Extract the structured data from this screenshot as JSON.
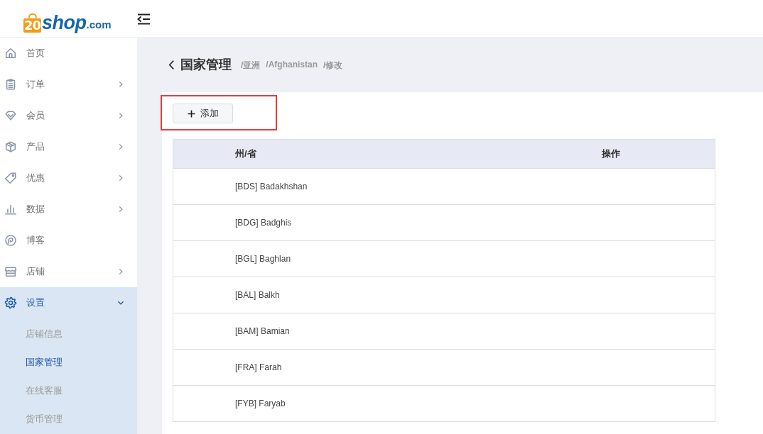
{
  "header": {
    "logo": {
      "badge": "20",
      "name": "shop",
      "domain": ".com"
    }
  },
  "sidebar": {
    "items": [
      {
        "label": "首页",
        "kind": "link",
        "selected": false
      },
      {
        "label": "订单",
        "kind": "group",
        "selected": false,
        "expanded": false
      },
      {
        "label": "会员",
        "kind": "group",
        "selected": false,
        "expanded": false
      },
      {
        "label": "产品",
        "kind": "group",
        "selected": false,
        "expanded": false
      },
      {
        "label": "优惠",
        "kind": "group",
        "selected": false,
        "expanded": false
      },
      {
        "label": "数据",
        "kind": "group",
        "selected": false,
        "expanded": false
      },
      {
        "label": "博客",
        "kind": "link",
        "selected": false
      },
      {
        "label": "店铺",
        "kind": "group",
        "selected": false,
        "expanded": false
      },
      {
        "label": "设置",
        "kind": "group",
        "selected": true,
        "expanded": true,
        "children": [
          {
            "label": "店铺信息",
            "selected": false
          },
          {
            "label": "国家管理",
            "selected": true
          },
          {
            "label": "在线客服",
            "selected": false
          },
          {
            "label": "货币管理",
            "selected": false
          }
        ]
      }
    ]
  },
  "page_header": {
    "title": "国家管理",
    "breadcrumb": [
      "/亚洲",
      "/Afghanistan",
      "/修改"
    ]
  },
  "toolbar": {
    "add_button": {
      "label": "添加",
      "highlighted": true
    }
  },
  "table": {
    "columns": [
      "州/省",
      "操作"
    ],
    "rows": [
      {
        "name": "[BDS] Badakhshan"
      },
      {
        "name": "[BDG] Badghis"
      },
      {
        "name": "[BGL] Baghlan"
      },
      {
        "name": "[BAL] Balkh"
      },
      {
        "name": "[BAM] Bamian"
      },
      {
        "name": "[FRA] Farah"
      },
      {
        "name": "[FYB] Faryab"
      }
    ]
  }
}
